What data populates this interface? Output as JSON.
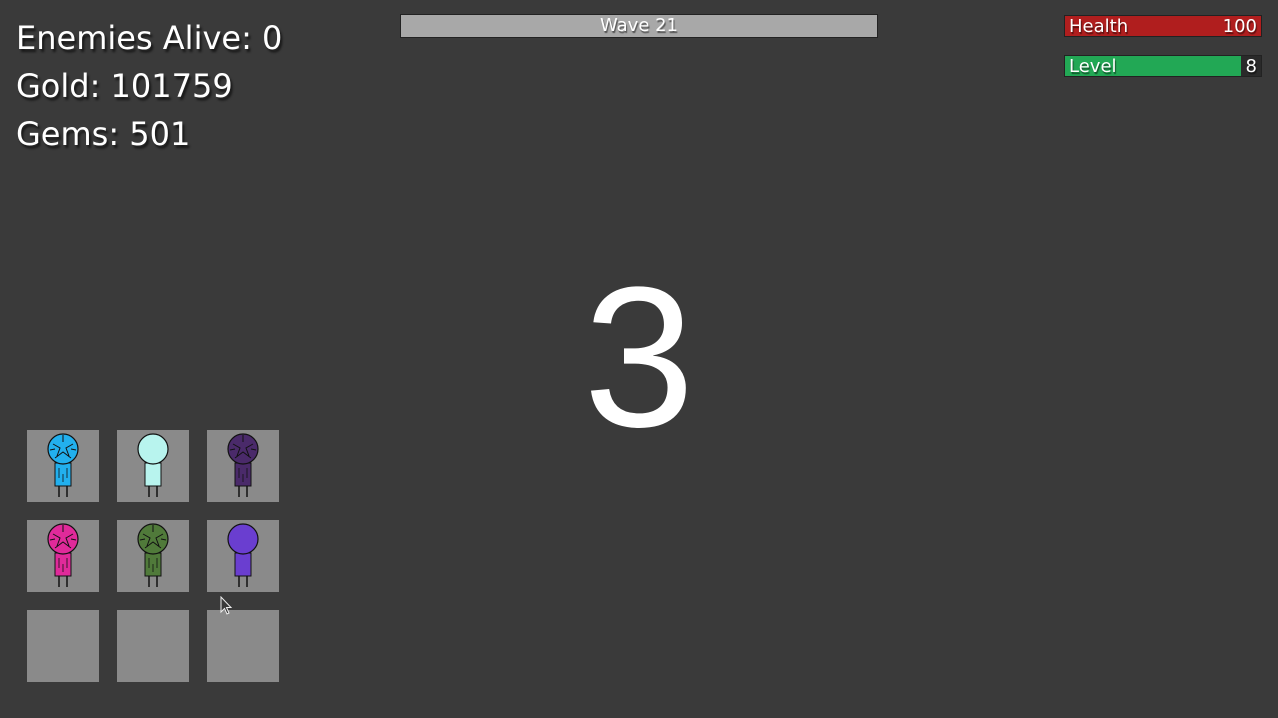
{
  "stats": {
    "enemies_alive": "Enemies Alive: 0",
    "gold": "Gold: 101759",
    "gems": "Gems: 501"
  },
  "wave": {
    "label": "Wave 21"
  },
  "health": {
    "label": "Health",
    "value": "100",
    "fill_fraction": 1.0,
    "color": "#b01e1e"
  },
  "level": {
    "label": "Level",
    "value": "8",
    "fill_fraction": 0.9,
    "color": "#22a855"
  },
  "countdown": "3",
  "inventory": {
    "slots": [
      {
        "icon": "blue-unit-icon",
        "color": "#22b0ee",
        "cracked": true
      },
      {
        "icon": "cyan-unit-icon",
        "color": "#b8f4ee",
        "cracked": false
      },
      {
        "icon": "purple-unit-icon",
        "color": "#4a2a6a",
        "cracked": true
      },
      {
        "icon": "pink-unit-icon",
        "color": "#e02a9a",
        "cracked": true
      },
      {
        "icon": "green-unit-icon",
        "color": "#507a3a",
        "cracked": true
      },
      {
        "icon": "violet-unit-icon",
        "color": "#6a3ed0",
        "cracked": false
      },
      {
        "icon": "empty-slot",
        "color": "",
        "cracked": false
      },
      {
        "icon": "empty-slot",
        "color": "",
        "cracked": false
      },
      {
        "icon": "empty-slot",
        "color": "",
        "cracked": false
      }
    ]
  }
}
